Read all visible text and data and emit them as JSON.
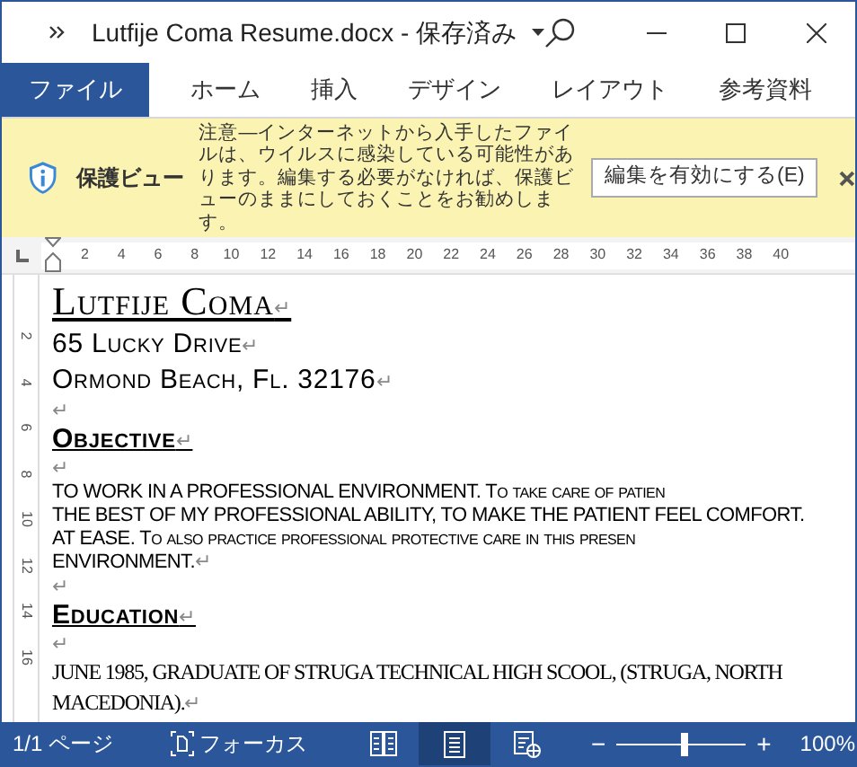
{
  "title_bar": {
    "title": "Lutfije Coma Resume.docx - 保存済み"
  },
  "ribbon_tabs": [
    {
      "label": "ファイル",
      "selected": true
    },
    {
      "label": "ホーム",
      "selected": false
    },
    {
      "label": "挿入",
      "selected": false
    },
    {
      "label": "デザイン",
      "selected": false
    },
    {
      "label": "レイアウト",
      "selected": false
    },
    {
      "label": "参考資料",
      "selected": false
    }
  ],
  "protected_view": {
    "title": "保護ビュー",
    "message": "注意—インターネットから入手したファイルは、ウイルスに感染している可能性があります。編集する必要がなければ、保護ビューのままにしておくことをお勧めします。",
    "button": "編集を有効にする(E)"
  },
  "ruler": {
    "ticks": [
      "2",
      "4",
      "6",
      "8",
      "10",
      "12",
      "14",
      "16",
      "18",
      "20",
      "22",
      "24",
      "26",
      "28",
      "30",
      "32",
      "34",
      "36",
      "38",
      "40"
    ]
  },
  "vertical_ruler": {
    "ticks": [
      "2",
      "4",
      "6",
      "8",
      "10",
      "12",
      "14",
      "16"
    ]
  },
  "paragraph_mark": "↵",
  "document": [
    {
      "kind": "name",
      "text": "Lutfije Coma",
      "mark": true
    },
    {
      "kind": "address",
      "text": "65 Lucky Drive",
      "mark": true
    },
    {
      "kind": "address",
      "text": "Ormond Beach, Fl. 32176",
      "mark": true
    },
    {
      "kind": "blank",
      "mark": true
    },
    {
      "kind": "heading",
      "text": "Objective",
      "mark": true
    },
    {
      "kind": "blank",
      "mark": true
    },
    {
      "kind": "body",
      "text": "TO WORK IN A PROFESSIONAL ENVIRONMENT.  To take care of patien",
      "mark": false
    },
    {
      "kind": "body",
      "text": "THE BEST OF MY PROFESSIONAL ABILITY, TO MAKE THE PATIENT FEEL COMFORT.",
      "mark": false
    },
    {
      "kind": "body",
      "text": "AT EASE. To also practice professional  protective care in this presen",
      "mark": false
    },
    {
      "kind": "body",
      "text": "ENVIRONMENT.",
      "mark": true
    },
    {
      "kind": "blank",
      "mark": true
    },
    {
      "kind": "heading",
      "text": "Education",
      "mark": true
    },
    {
      "kind": "blank",
      "mark": true
    },
    {
      "kind": "serif",
      "text": "JUNE 1985, GRADUATE OF STRUGA TECHNICAL HIGH SCOOL, (STRUGA, NORTH",
      "mark": false
    },
    {
      "kind": "serif",
      "text": "MACEDONIA).",
      "mark": true
    }
  ],
  "status_bar": {
    "page": "1/1 ページ",
    "focus": "フォーカス",
    "views": [
      {
        "kind": "read",
        "selected": false
      },
      {
        "kind": "print",
        "selected": true
      },
      {
        "kind": "web",
        "selected": false
      }
    ],
    "zoom": {
      "level": 0.52,
      "minus": "−",
      "plus": "+",
      "reading": "100%"
    }
  }
}
